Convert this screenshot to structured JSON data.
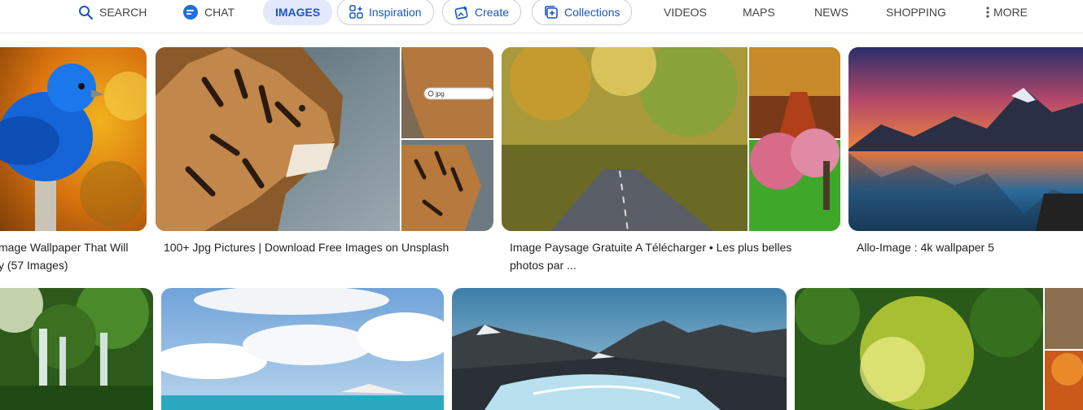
{
  "nav": {
    "search": "SEARCH",
    "chat": "CHAT",
    "images": "IMAGES",
    "inspiration": "Inspiration",
    "create": "Create",
    "collections": "Collections",
    "videos": "VIDEOS",
    "maps": "MAPS",
    "news": "NEWS",
    "shopping": "SHOPPING",
    "more": "MORE"
  },
  "results": [
    {
      "caption_line1": "mage Wallpaper That Will",
      "caption_line2": "y (57 Images)"
    },
    {
      "caption_line1": "100+ Jpg Pictures | Download Free Images on Unsplash",
      "caption_line2": ""
    },
    {
      "caption_line1": "Image Paysage Gratuite A Télécharger • Les plus belles",
      "caption_line2": "photos par ..."
    },
    {
      "caption_line1": "Allo-Image : 4k wallpaper 5",
      "caption_line2": ""
    }
  ],
  "thumb_search_text": "jpg",
  "colors": {
    "accent": "#1a56c7",
    "active_bg": "#e3e8fb",
    "pill_border": "#c9cdd6"
  }
}
